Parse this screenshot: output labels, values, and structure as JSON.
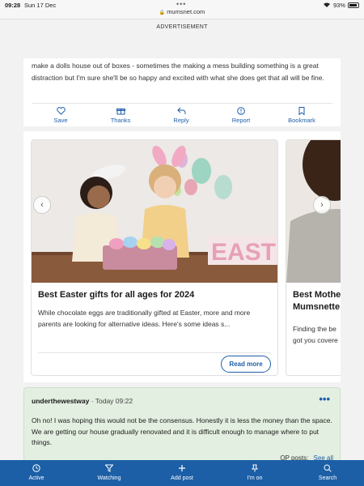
{
  "status_bar": {
    "time": "09:28",
    "date": "Sun 17 Dec",
    "battery": "93%"
  },
  "browser": {
    "url": "mumsnet.com"
  },
  "advertisement": {
    "label": "ADVERTISEMENT"
  },
  "post": {
    "text": "make a dolls house out of boxes - sometimes the making a mess building something is a great distraction but I'm sure she'll be so happy and excited with what she does get that all will be fine.",
    "actions": [
      {
        "label": "Save",
        "icon": "heart-icon"
      },
      {
        "label": "Thanks",
        "icon": "gift-icon"
      },
      {
        "label": "Reply",
        "icon": "reply-icon"
      },
      {
        "label": "Report",
        "icon": "report-icon"
      },
      {
        "label": "Bookmark",
        "icon": "bookmark-icon"
      }
    ]
  },
  "carousel": {
    "cards": [
      {
        "title": "Best Easter gifts for all ages for 2024",
        "description": "While chocolate eggs are traditionally gifted at Easter, more and more parents are looking for alternative ideas. Here's some ideas s...",
        "button": "Read more",
        "image_text": "EASTER"
      },
      {
        "title": "Best Mother's Day gifts Mumsnetters",
        "title_line1": "Best Mothe",
        "title_line2": "Mumsnette",
        "description_line1": "Finding the be",
        "description_line2": "got you covere"
      }
    ]
  },
  "reply": {
    "author": "underthewestway",
    "time": "Today 09:22",
    "body": "Oh no! I was hoping this would not be the consensus. Honestly it is less the money than the space. We are getting our house gradually renovated and it is difficult enough to manage where to put things.",
    "op_posts_label": "OP posts:",
    "see_all": "See all"
  },
  "tabbar": [
    {
      "label": "Active",
      "icon": "clock-icon"
    },
    {
      "label": "Watching",
      "icon": "filter-icon"
    },
    {
      "label": "Add post",
      "icon": "plus-icon"
    },
    {
      "label": "I'm on",
      "icon": "pin-icon"
    },
    {
      "label": "Search",
      "icon": "search-icon"
    }
  ],
  "colors": {
    "accent": "#1c5fa6",
    "reply_bg": "#e3efe0"
  }
}
